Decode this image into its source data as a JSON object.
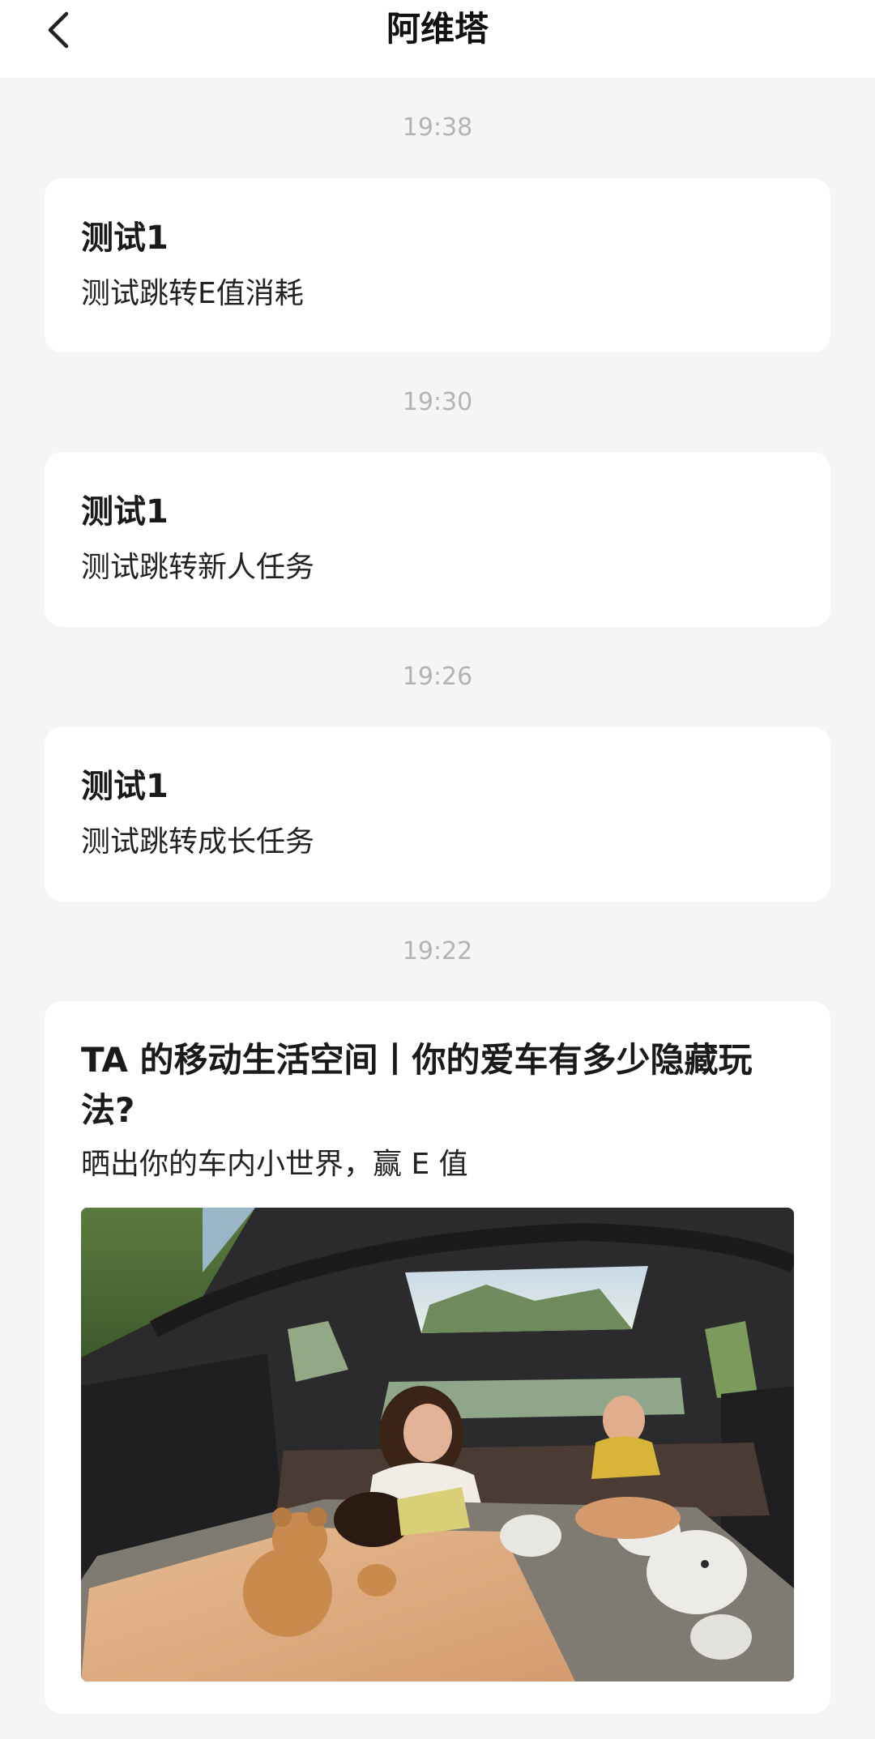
{
  "header": {
    "title": "阿维塔",
    "back_icon": "chevron-left-icon"
  },
  "messages": [
    {
      "time": "19:38",
      "title": "测试1",
      "body": "测试跳转E值消耗"
    },
    {
      "time": "19:30",
      "title": "测试1",
      "body": "测试跳转新人任务"
    },
    {
      "time": "19:26",
      "title": "测试1",
      "body": "测试跳转成长任务"
    }
  ],
  "promo": {
    "time": "19:22",
    "title": "TA 的移动生活空间丨你的爱车有多少隐藏玩法?",
    "subtitle": "晒出你的车内小世界，赢 E 值",
    "image_icon": "car-interior-photo"
  },
  "colors": {
    "background": "#f5f5f5",
    "card": "#ffffff",
    "time_text": "#b3b3b3",
    "title_text": "#1a1a1a"
  }
}
